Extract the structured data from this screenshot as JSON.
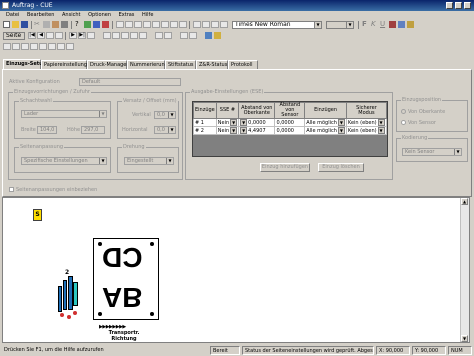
{
  "window": {
    "title": "Auftrag - CUE"
  },
  "menu": [
    "Datei",
    "Bearbeiten",
    "Ansicht",
    "Optionen",
    "Extras",
    "Hilfe"
  ],
  "toolbar": {
    "font_name": "Times New Roman"
  },
  "toolbar2": {
    "page_label": "Seite"
  },
  "tabs": [
    "Einzugs-Setup",
    "Papiereinstellungen",
    "Druck-Manager",
    "Nummerierung",
    "Stiftstatus",
    "Z&R-Status",
    "Protokoll"
  ],
  "left": {
    "aktive_label": "Aktive Konfiguration",
    "aktive_value": "Default",
    "einzug_group": "Einzugsvorrichtungen / Zufuhr",
    "schacht_group": "Schachtwahl",
    "schacht_value": "Lader",
    "breite_label": "Breite",
    "breite_value": "104,0",
    "hoehe_label": "Höhe",
    "hoehe_value": "297,0",
    "offset_group": "Versatz / Offset (mm)",
    "vertikal_label": "Vertikal",
    "vertikal_value": "0,0",
    "horizontal_label": "Horizontal",
    "horizontal_value": "0,0",
    "einst_group": "Seitenanpassung",
    "einst_value": "Spezifische Einstellungen",
    "drehung_group": "Drehung",
    "drehung_value": "Eingestellt",
    "checkbox_label": "Seitenanpassungen einbeziehen"
  },
  "table": {
    "group_label": "Ausgabe-Einstellungen (ESE)",
    "headers": [
      "Einzüge",
      "SSE #",
      "Abstand von Oberkante",
      "Abstand von Sensor",
      "Einzügen",
      "Sicherer Modus"
    ],
    "rows": [
      {
        "name": "# 1",
        "sse": "Nein",
        "abst_oben": "0,0000",
        "abst_sensor": "0,0000",
        "einzuegen": "Alle möglich",
        "modus": "Kein (eben)"
      },
      {
        "name": "# 2",
        "sse": "Nein",
        "abst_oben": "4,4907",
        "abst_sensor": "0,0000",
        "einzuegen": "Alle möglich",
        "modus": "Kein (eben)"
      }
    ],
    "btn_add": "Einzug hinzufügen",
    "btn_remove": "Einzug löschen"
  },
  "right": {
    "trimm_group": "Einzugsposition",
    "radio1": "Von Oberkante",
    "radio2": "Von Sensor",
    "kodierung_group": "Kodierung",
    "kodierung_value": "Kein Sensor"
  },
  "preview": {
    "badge": "S",
    "upper_text": "CD",
    "lower_text": "AB",
    "number_label": "2",
    "arrows": "▶▶▶▶▶▶▶▶",
    "caption1": "Transportr.",
    "caption2": "Richtung"
  },
  "status": {
    "help": "Drücken Sie F1, um die Hilfe aufzurufen",
    "s1": "Bereit",
    "s2": "Status der Seiteneinstellungen wird geprüft. Abgestellt",
    "s3": "X: 90,000",
    "s4": "Y: 90,000",
    "s5": "NUM"
  },
  "colors": {
    "title_from": "#0a246a",
    "title_to": "#3a6ea5",
    "selected_row": "#1c5fbd",
    "badge": "#ffde00"
  }
}
